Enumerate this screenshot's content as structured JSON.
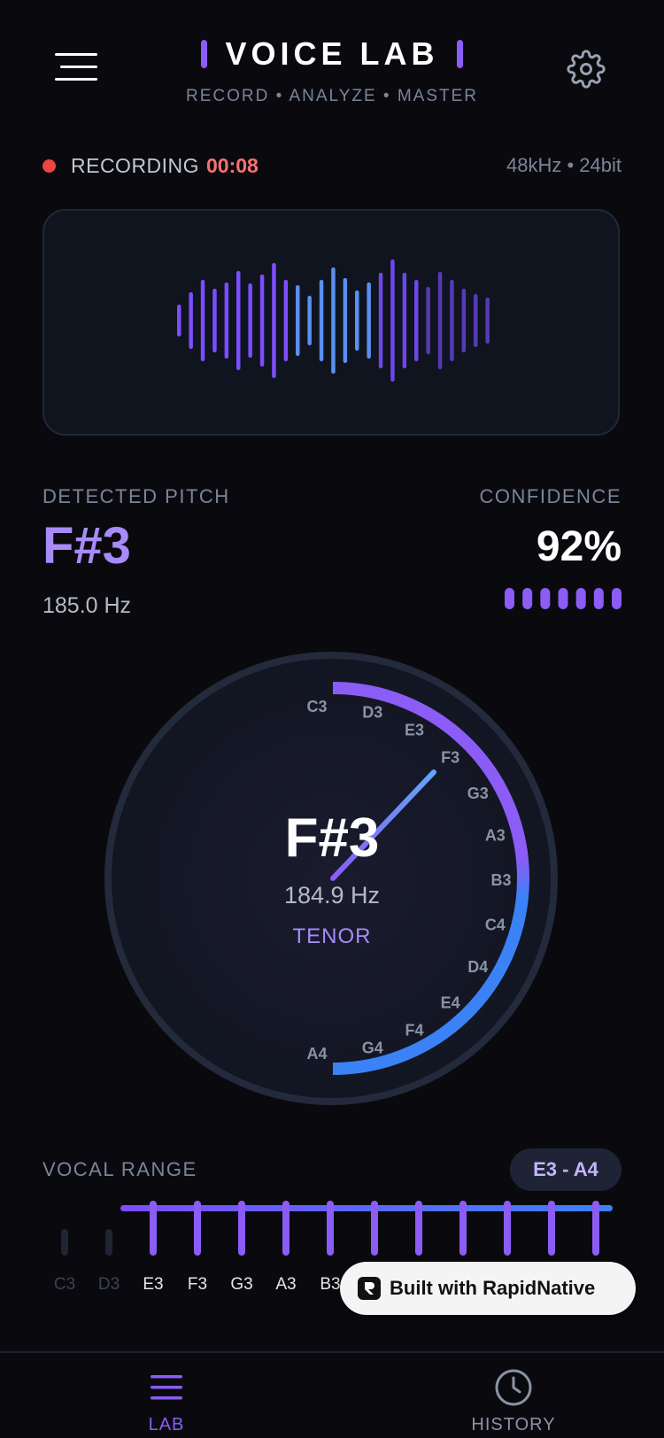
{
  "header": {
    "title": "VOICE LAB",
    "subtitle": "RECORD • ANALYZE • MASTER"
  },
  "recording": {
    "label": "RECORDING",
    "time": "00:08",
    "format": "48kHz • 24bit"
  },
  "pitch": {
    "label": "DETECTED PITCH",
    "note": "F#3",
    "hz": "185.0 Hz"
  },
  "confidence": {
    "label": "CONFIDENCE",
    "value": "92%",
    "segments_total": 7,
    "segments_active": 7
  },
  "dial": {
    "note": "F#3",
    "hz": "184.9 Hz",
    "voice_type": "TENOR",
    "notes": [
      "C3",
      "D3",
      "E3",
      "F3",
      "G3",
      "A3",
      "B3",
      "C4",
      "D4",
      "E4",
      "F4",
      "G4",
      "A4"
    ]
  },
  "vocal_range": {
    "label": "VOCAL RANGE",
    "range": "E3 - A4",
    "notes": [
      "C3",
      "D3",
      "E3",
      "F3",
      "G3",
      "A3",
      "B3"
    ],
    "in_range_from": 2
  },
  "badge": {
    "text": "Built with RapidNative"
  },
  "nav": {
    "lab": "LAB",
    "history": "HISTORY"
  },
  "colors": {
    "accent": "#8b5cf6",
    "accent_light": "#a78bfa",
    "blue": "#3b82f6",
    "recording": "#ef4444"
  },
  "icons": {
    "menu": "menu-icon",
    "settings": "gear-icon",
    "lab": "list-icon",
    "history": "clock-icon"
  }
}
